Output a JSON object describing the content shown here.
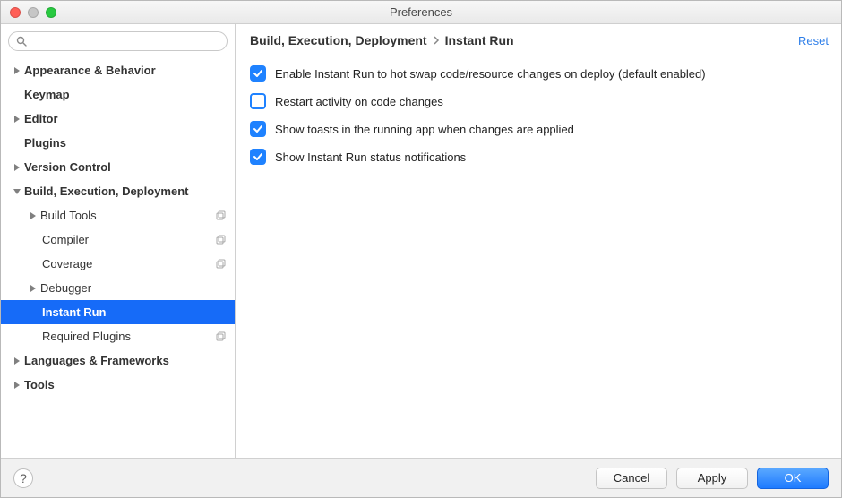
{
  "window": {
    "title": "Preferences"
  },
  "sidebar": {
    "search": {
      "placeholder": ""
    },
    "rows": [
      {
        "label": "Appearance & Behavior"
      },
      {
        "label": "Keymap"
      },
      {
        "label": "Editor"
      },
      {
        "label": "Plugins"
      },
      {
        "label": "Version Control"
      },
      {
        "label": "Build, Execution, Deployment"
      },
      {
        "label": "Build Tools"
      },
      {
        "label": "Compiler"
      },
      {
        "label": "Coverage"
      },
      {
        "label": "Debugger"
      },
      {
        "label": "Instant Run"
      },
      {
        "label": "Required Plugins"
      },
      {
        "label": "Languages & Frameworks"
      },
      {
        "label": "Tools"
      }
    ]
  },
  "breadcrumb": {
    "root": "Build, Execution, Deployment",
    "leaf": "Instant Run",
    "reset": "Reset"
  },
  "options": [
    {
      "checked": true,
      "label": "Enable Instant Run to hot swap code/resource changes on deploy (default enabled)"
    },
    {
      "checked": false,
      "label": "Restart activity on code changes"
    },
    {
      "checked": true,
      "label": "Show toasts in the running app when changes are applied"
    },
    {
      "checked": true,
      "label": "Show Instant Run status notifications"
    }
  ],
  "buttons": {
    "help": "?",
    "cancel": "Cancel",
    "apply": "Apply",
    "ok": "OK"
  }
}
